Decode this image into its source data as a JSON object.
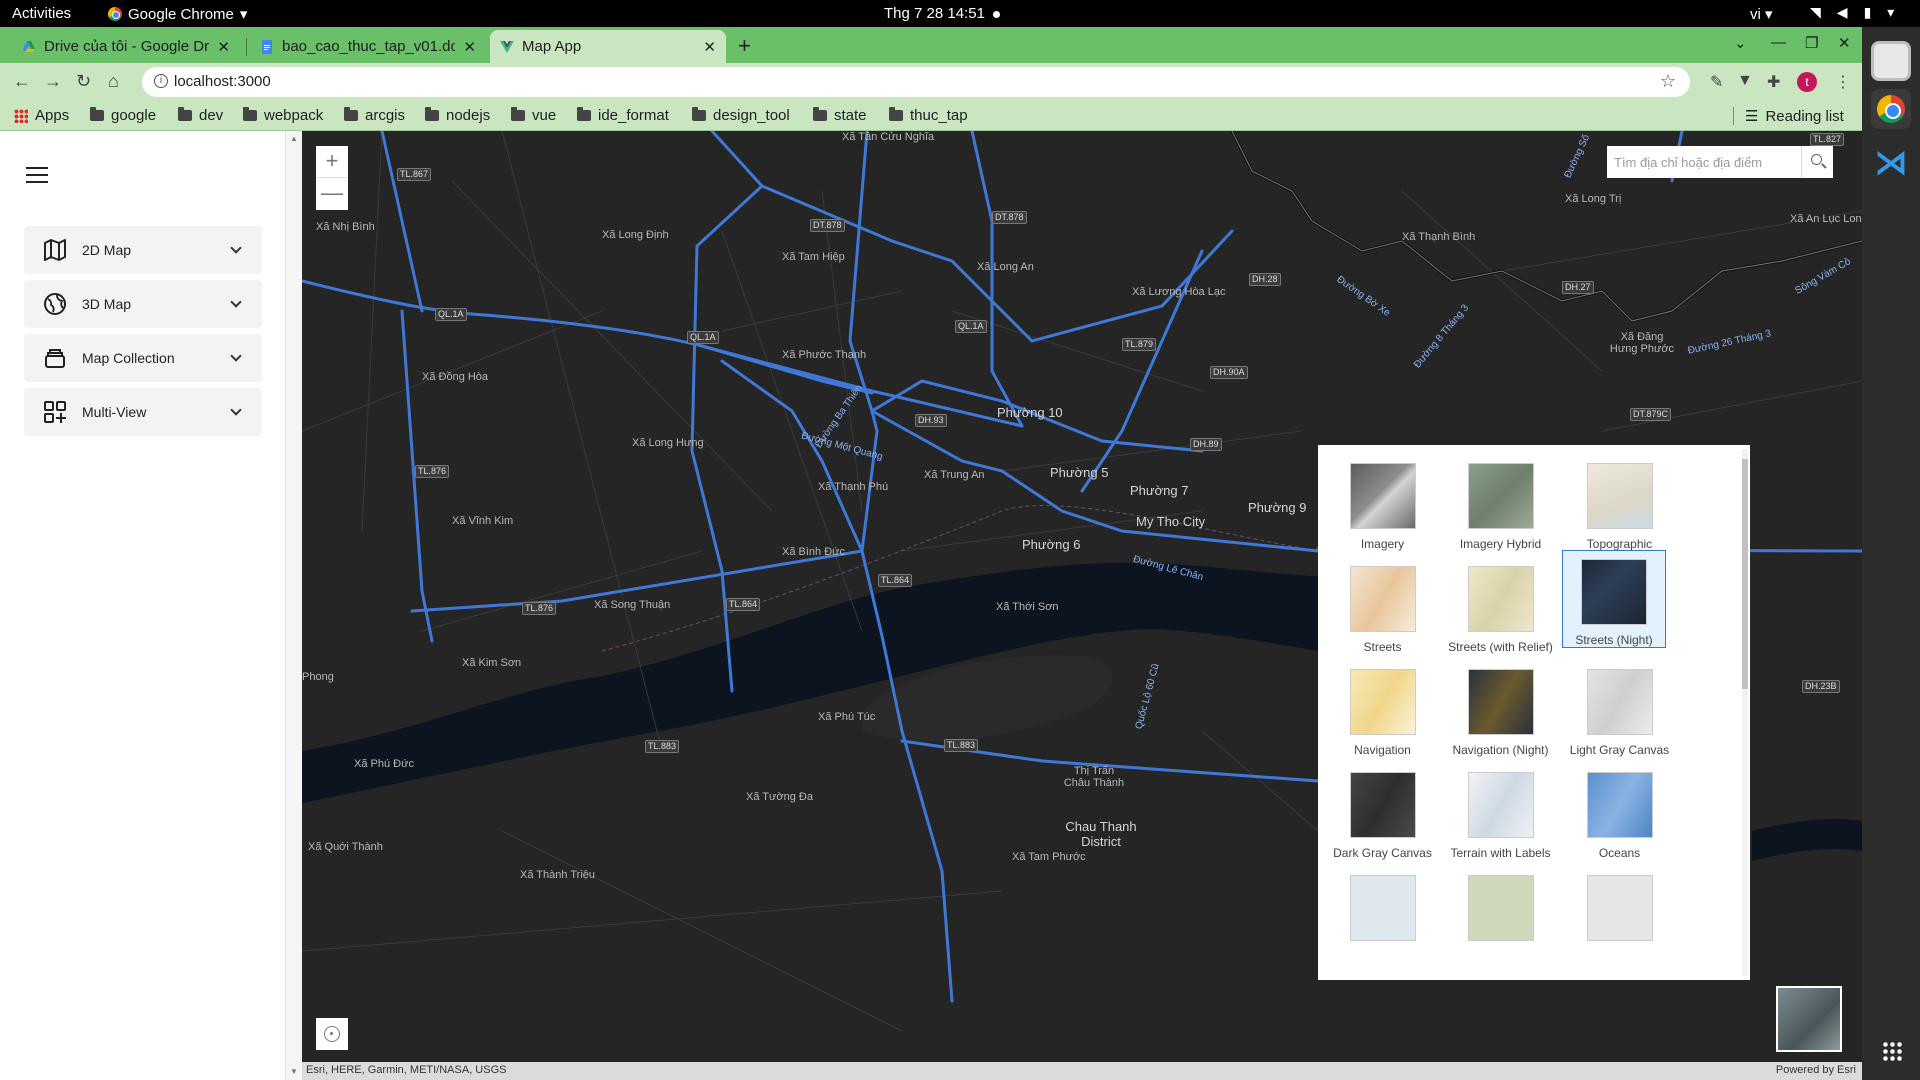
{
  "os": {
    "activities": "Activities",
    "app_name": "Google Chrome",
    "clock": "Thg 7 28  14:51",
    "lang": "vi"
  },
  "browser": {
    "tabs": [
      {
        "title": "Drive của tôi - Google Dri",
        "icon": "google-drive-icon"
      },
      {
        "title": "bao_cao_thuc_tap_v01.do",
        "icon": "google-docs-icon"
      },
      {
        "title": "Map App",
        "icon": "vue-icon"
      }
    ],
    "url": "localhost:3000",
    "bookmarks": [
      "Apps",
      "google",
      "dev",
      "webpack",
      "arcgis",
      "nodejs",
      "vue",
      "ide_format",
      "design_tool",
      "state",
      "thuc_tap"
    ],
    "reading_list": "Reading list",
    "profile_initial": "t"
  },
  "sidebar": {
    "items": [
      {
        "label": "2D Map",
        "icon": "map-icon"
      },
      {
        "label": "3D Map",
        "icon": "globe-icon"
      },
      {
        "label": "Map Collection",
        "icon": "layers-icon"
      },
      {
        "label": "Multi-View",
        "icon": "grid-plus-icon"
      }
    ]
  },
  "map": {
    "search_placeholder": "Tìm địa chỉ hoặc địa điểm",
    "zoom_in": "+",
    "zoom_out": "—",
    "attribution_left": "Esri, HERE, Garmin, METI/NASA, USGS",
    "attribution_right": "Powered by Esri",
    "labels": [
      "Xã Tân Cửu Nghĩa",
      "Xã Nhị Bình",
      "Xã Long Định",
      "Xã Tam Hiệp",
      "Xã Long An",
      "Xã Lương Hòa Lạc",
      "Xã Thạnh Bình",
      "Xã Long Trị",
      "Xã An Lục Long",
      "Xã Đồng Hòa",
      "Xã Phước Thạnh",
      "Phường 10",
      "Xã Long Hưng",
      "Xã Thạnh Phú",
      "Xã Trung An",
      "Phường 5",
      "Phường 7",
      "Phường 9",
      "Xã Vĩnh Kim",
      "My Tho City",
      "Xã Bình Đức",
      "Phường 6",
      "Xã Song Thuận",
      "Xã Thới Sơn",
      "Xã Kim Sơn",
      "Xã Phú Túc",
      "Xã Phú Đức",
      "Xã Tường Đa",
      "Thị Trấn Châu Thành",
      "Chau Thanh District",
      "Xã Quới Thành",
      "Xã Tam Phước",
      "Xã Thành Triệu",
      "Xã Đăng Hưng Phước",
      "Phong"
    ],
    "shields": [
      "TL.867",
      "DT.878",
      "DT.878",
      "QL.1A",
      "QL.1A",
      "QL.1A",
      "DH.28",
      "DH.27",
      "TL.879",
      "DH.90A",
      "DH.93",
      "DH.89",
      "DT.879C",
      "TL.876",
      "TL.864",
      "TL.864",
      "TL.876",
      "TL.883",
      "TL.883",
      "DH.23B",
      "TL.827"
    ],
    "road_labels": [
      "Đường Ba Thiên",
      "Đường Một Quang",
      "Đường Lê Chân",
      "Đường Bờ Xe",
      "Đường 8 Tháng 3",
      "Đường 26 Tháng 3",
      "Quốc Lộ 60 Cũ",
      "Đường Số",
      "Sông Vàm Cỏ"
    ]
  },
  "basemaps": [
    {
      "label": "Imagery",
      "selected": false,
      "color": "#6f6f6f"
    },
    {
      "label": "Imagery Hybrid",
      "selected": false,
      "color": "#7a8a78"
    },
    {
      "label": "Topographic",
      "selected": false,
      "color": "#e6e2d6"
    },
    {
      "label": "Streets",
      "selected": false,
      "color": "#efe1c8"
    },
    {
      "label": "Streets (with Relief)",
      "selected": false,
      "color": "#ece6c4"
    },
    {
      "label": "Streets (Night)",
      "selected": true,
      "color": "#1f2b3a"
    },
    {
      "label": "Navigation",
      "selected": false,
      "color": "#f6e7b8"
    },
    {
      "label": "Navigation (Night)",
      "selected": false,
      "color": "#2b3140"
    },
    {
      "label": "Light Gray Canvas",
      "selected": false,
      "color": "#dadada"
    },
    {
      "label": "Dark Gray Canvas",
      "selected": false,
      "color": "#3a3a3a"
    },
    {
      "label": "Terrain with Labels",
      "selected": false,
      "color": "#e6ecef"
    },
    {
      "label": "Oceans",
      "selected": false,
      "color": "#6f9ed6"
    }
  ],
  "colors": {
    "tab_strip": "#6abf69",
    "toolbar": "#c9e6c1",
    "map_bg": "#252525",
    "road": "#3f78d6",
    "river": "#0c1420"
  }
}
